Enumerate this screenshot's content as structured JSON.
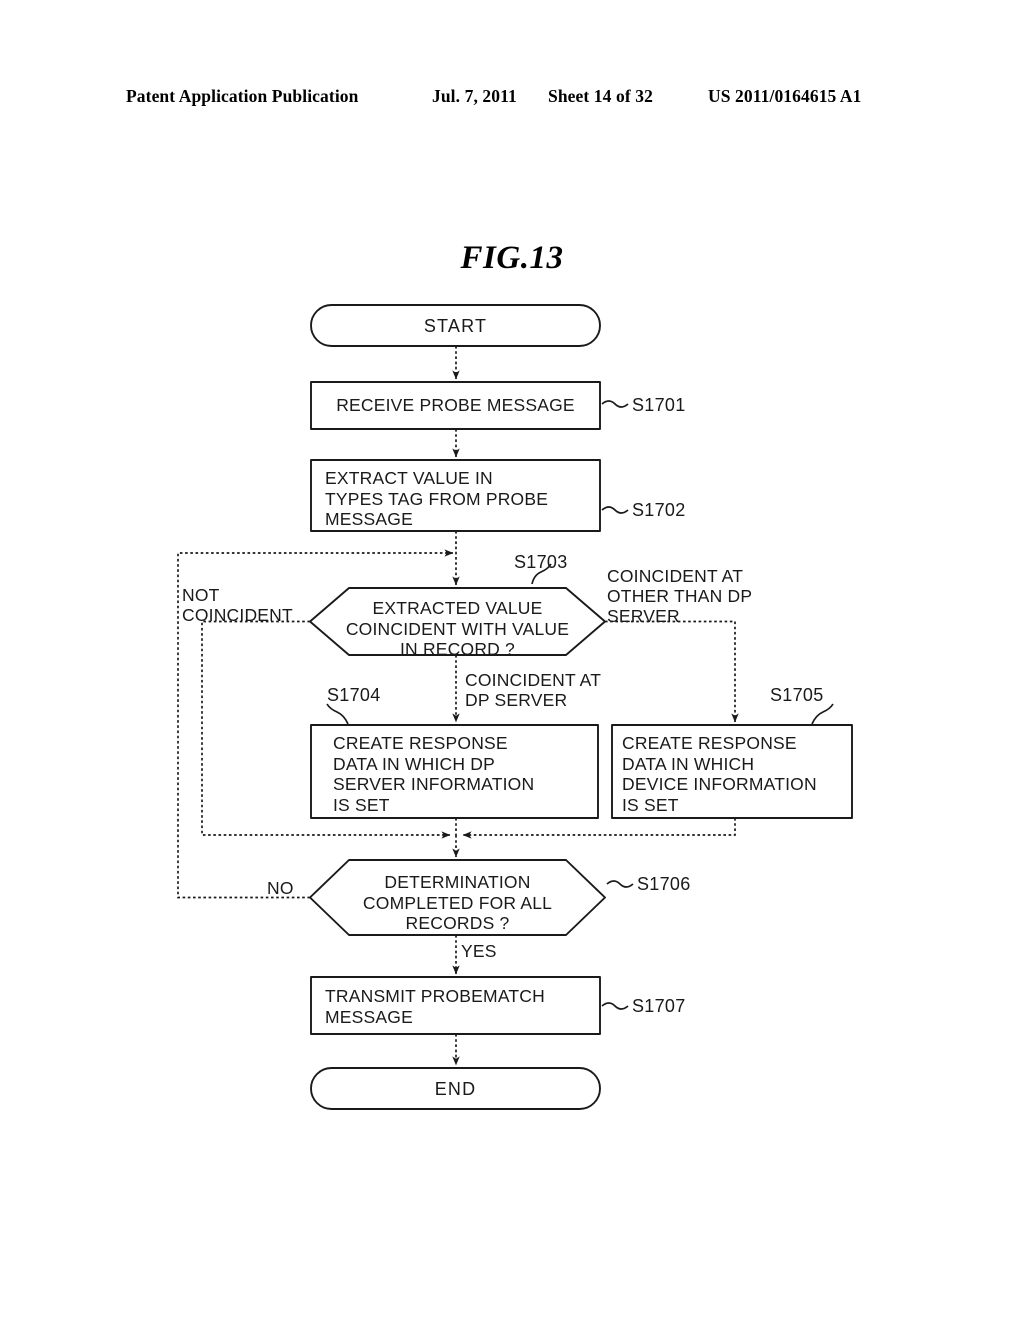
{
  "header": {
    "publication": "Patent Application Publication",
    "date": "Jul. 7, 2011",
    "sheet": "Sheet 14 of 32",
    "patent_number": "US 2011/0164615 A1"
  },
  "figure": {
    "title": "FIG.13"
  },
  "flowchart": {
    "nodes": [
      {
        "id": "start",
        "type": "terminal",
        "label": "START"
      },
      {
        "id": "s1701",
        "type": "process",
        "label": "RECEIVE PROBE MESSAGE",
        "step": "S1701"
      },
      {
        "id": "s1702",
        "type": "process",
        "label": "EXTRACT VALUE IN\nTYPES TAG FROM PROBE\nMESSAGE",
        "step": "S1702"
      },
      {
        "id": "s1703",
        "type": "decision",
        "label": "EXTRACTED VALUE\nCOINCIDENT WITH VALUE\nIN RECORD ?",
        "step": "S1703"
      },
      {
        "id": "s1704",
        "type": "process",
        "label": "CREATE RESPONSE\nDATA IN WHICH DP\nSERVER INFORMATION\nIS SET",
        "step": "S1704"
      },
      {
        "id": "s1705",
        "type": "process",
        "label": "CREATE RESPONSE\nDATA IN WHICH\nDEVICE INFORMATION\nIS SET",
        "step": "S1705"
      },
      {
        "id": "s1706",
        "type": "decision",
        "label": "DETERMINATION\nCOMPLETED FOR ALL\nRECORDS ?",
        "step": "S1706"
      },
      {
        "id": "s1707",
        "type": "process",
        "label": "TRANSMIT PROBEMATCH\nMESSAGE",
        "step": "S1707"
      },
      {
        "id": "end",
        "type": "terminal",
        "label": "END"
      }
    ],
    "edge_labels": {
      "not_coincident": "NOT\nCOINCIDENT",
      "coincident_other": "COINCIDENT AT\nOTHER THAN DP\nSERVER",
      "coincident_dp": "COINCIDENT AT\nDP SERVER",
      "no": "NO",
      "yes": "YES"
    }
  }
}
